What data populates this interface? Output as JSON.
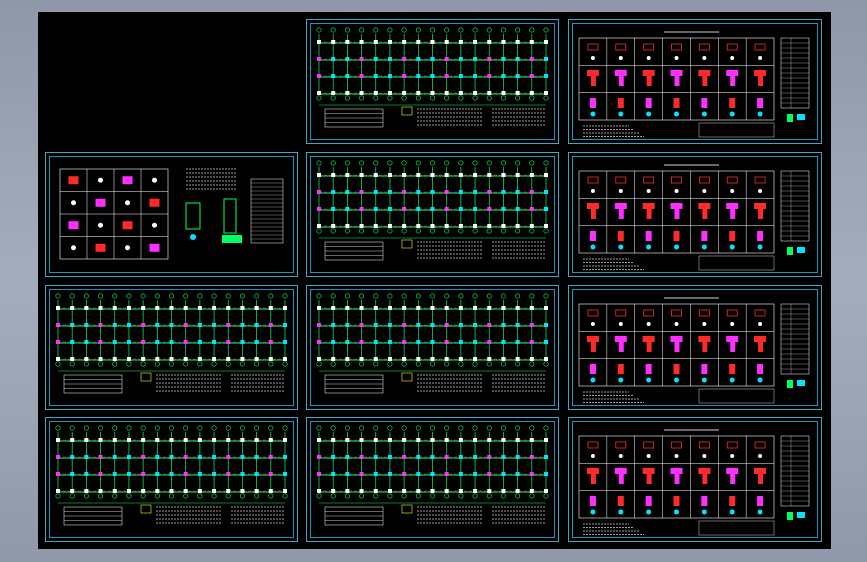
{
  "app": {
    "type": "cad-model-space-viewport"
  },
  "colors": {
    "background": "#000000",
    "frame": "#3aa7c9",
    "beam": "#00ff60",
    "axis": "#ff2a2a",
    "column": "#ffffff",
    "node_a": "#00e5ff",
    "node_b": "#ff30ff",
    "node_c": "#ffff00",
    "text": "#d0d0d0",
    "table": "#ffffff"
  },
  "sheets": [
    {
      "id": "plan-1",
      "kind": "plan"
    },
    {
      "id": "detail-1",
      "kind": "detail"
    },
    {
      "id": "table-1",
      "kind": "table"
    },
    {
      "id": "plan-2",
      "kind": "plan"
    },
    {
      "id": "detail-2",
      "kind": "detail"
    },
    {
      "id": "plan-3",
      "kind": "plan"
    },
    {
      "id": "plan-4",
      "kind": "plan"
    },
    {
      "id": "detail-3",
      "kind": "detail"
    },
    {
      "id": "plan-5",
      "kind": "plan"
    },
    {
      "id": "plan-6",
      "kind": "plan"
    },
    {
      "id": "detail-4",
      "kind": "detail"
    }
  ]
}
